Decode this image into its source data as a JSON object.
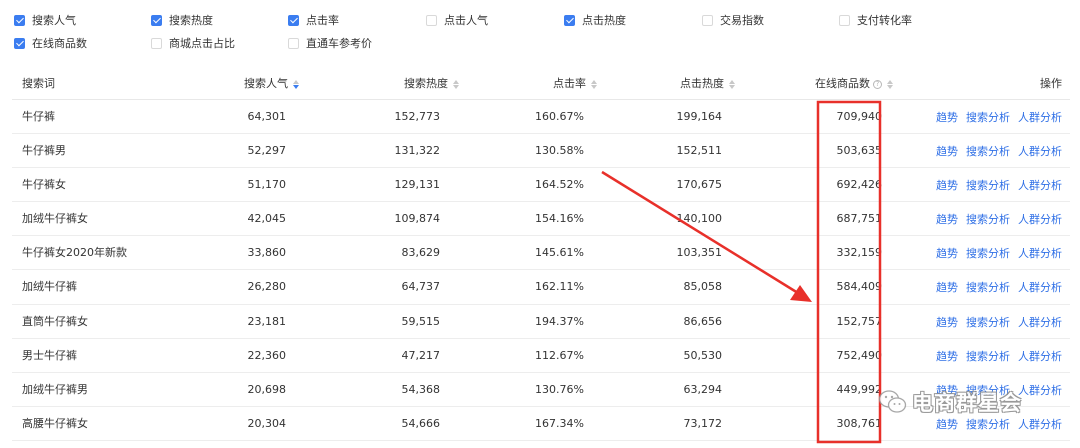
{
  "filters": [
    {
      "label": "搜索人气",
      "checked": true
    },
    {
      "label": "搜索热度",
      "checked": true
    },
    {
      "label": "点击率",
      "checked": true
    },
    {
      "label": "点击人气",
      "checked": false
    },
    {
      "label": "点击热度",
      "checked": true
    },
    {
      "label": "交易指数",
      "checked": false
    },
    {
      "label": "支付转化率",
      "checked": false
    },
    {
      "label": "在线商品数",
      "checked": true
    },
    {
      "label": "商城点击占比",
      "checked": false
    },
    {
      "label": "直通车参考价",
      "checked": false
    }
  ],
  "table": {
    "headers": {
      "keyword": "搜索词",
      "search_popularity": "搜索人气",
      "search_heat": "搜索热度",
      "click_rate": "点击率",
      "click_heat": "点击热度",
      "online_items": "在线商品数",
      "actions": "操作"
    },
    "action_labels": {
      "trend": "趋势",
      "search_analysis": "搜索分析",
      "crowd_analysis": "人群分析"
    },
    "rows": [
      {
        "keyword": "牛仔裤",
        "search_popularity": "64,301",
        "search_heat": "152,773",
        "click_rate": "160.67%",
        "click_heat": "199,164",
        "online_items": "709,940"
      },
      {
        "keyword": "牛仔裤男",
        "search_popularity": "52,297",
        "search_heat": "131,322",
        "click_rate": "130.58%",
        "click_heat": "152,511",
        "online_items": "503,635"
      },
      {
        "keyword": "牛仔裤女",
        "search_popularity": "51,170",
        "search_heat": "129,131",
        "click_rate": "164.52%",
        "click_heat": "170,675",
        "online_items": "692,426"
      },
      {
        "keyword": "加绒牛仔裤女",
        "search_popularity": "42,045",
        "search_heat": "109,874",
        "click_rate": "154.16%",
        "click_heat": "140,100",
        "online_items": "687,751"
      },
      {
        "keyword": "牛仔裤女2020年新款",
        "search_popularity": "33,860",
        "search_heat": "83,629",
        "click_rate": "145.61%",
        "click_heat": "103,351",
        "online_items": "332,159"
      },
      {
        "keyword": "加绒牛仔裤",
        "search_popularity": "26,280",
        "search_heat": "64,737",
        "click_rate": "162.11%",
        "click_heat": "85,058",
        "online_items": "584,409"
      },
      {
        "keyword": "直筒牛仔裤女",
        "search_popularity": "23,181",
        "search_heat": "59,515",
        "click_rate": "194.37%",
        "click_heat": "86,656",
        "online_items": "152,757"
      },
      {
        "keyword": "男士牛仔裤",
        "search_popularity": "22,360",
        "search_heat": "47,217",
        "click_rate": "112.67%",
        "click_heat": "50,530",
        "online_items": "752,490"
      },
      {
        "keyword": "加绒牛仔裤男",
        "search_popularity": "20,698",
        "search_heat": "54,368",
        "click_rate": "130.76%",
        "click_heat": "63,294",
        "online_items": "449,992"
      },
      {
        "keyword": "高腰牛仔裤女",
        "search_popularity": "20,304",
        "search_heat": "54,666",
        "click_rate": "167.34%",
        "click_heat": "73,172",
        "online_items": "308,761"
      }
    ]
  },
  "annotation": {
    "color": "#e8302a"
  },
  "watermark": {
    "text": "电商群星会"
  },
  "colors": {
    "accent": "#3b7df0",
    "link": "#2f6fe6",
    "highlight": "#e8302a"
  }
}
